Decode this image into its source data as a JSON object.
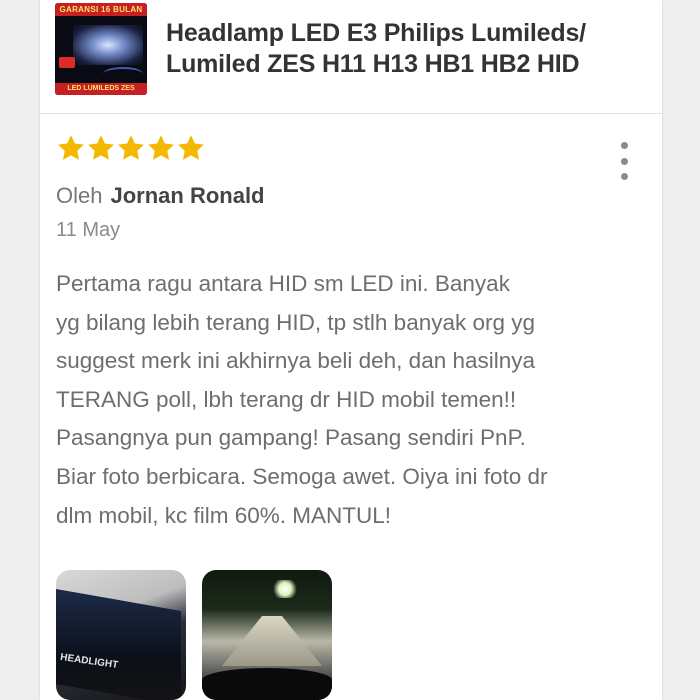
{
  "product": {
    "title": "Headlamp LED E3 Philips Lumileds/ Lumiled ZES H11 H13 HB1 HB2 HID",
    "thumbnail": {
      "top_banner": "GARANSI 16 BULAN",
      "bottom_banner": "LED LUMILEDS ZES"
    }
  },
  "review": {
    "rating": 5,
    "max_rating": 5,
    "star_color": "#f5b800",
    "by_label": "Oleh",
    "author": "Jornan Ronald",
    "date": "11 May",
    "text": "Pertama ragu antara HID sm LED ini. Banyak\nyg bilang lebih terang HID, tp stlh banyak org yg\nsuggest merk ini akhirnya beli deh, dan hasilnya\nTERANG poll, lbh terang dr HID mobil temen!!\nPasangnya pun gampang! Pasang sendiri PnP.\nBiar foto berbicara. Semoga awet. Oiya ini foto dr\ndlm mobil, kc film 60%. MANTUL!",
    "photos": [
      {
        "icon": "photo-thumbnail",
        "caption": "HEADLIGHT"
      },
      {
        "icon": "photo-thumbnail"
      }
    ]
  }
}
